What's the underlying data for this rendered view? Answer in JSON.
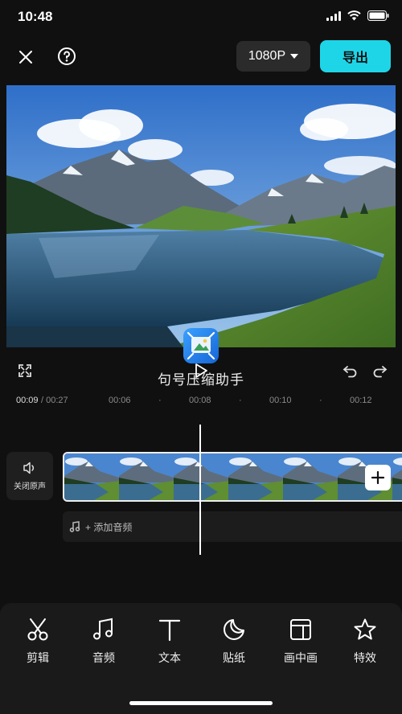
{
  "status": {
    "time": "10:48"
  },
  "header": {
    "resolution": "1080P",
    "export_label": "导出"
  },
  "watermark": {
    "text": "句号压缩助手"
  },
  "timeline": {
    "current_time": "00:09",
    "total_time": "/ 00:27",
    "ticks": [
      "00:06",
      "00:08",
      "00:10",
      "00:12"
    ]
  },
  "track": {
    "mute_label": "关闭原声",
    "add_audio_label": "+ 添加音频"
  },
  "toolbar": {
    "items": [
      {
        "label": "剪辑",
        "icon": "scissors-icon"
      },
      {
        "label": "音频",
        "icon": "music-note-icon"
      },
      {
        "label": "文本",
        "icon": "text-icon"
      },
      {
        "label": "贴纸",
        "icon": "sticker-icon"
      },
      {
        "label": "画中画",
        "icon": "picture-in-picture-icon"
      },
      {
        "label": "特效",
        "icon": "star-icon"
      }
    ]
  },
  "colors": {
    "accent": "#1ed5e8",
    "background": "#101010"
  }
}
